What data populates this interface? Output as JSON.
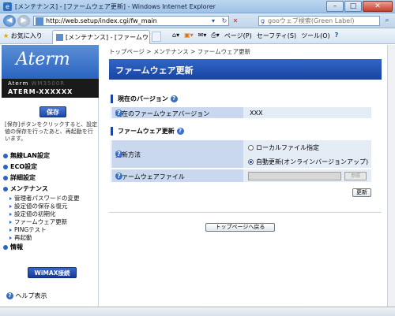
{
  "window": {
    "title": "[メンテナンス] - [ファームウェア更新] - Windows Internet Explorer",
    "minimize": "–",
    "maximize": "□",
    "close": "✕"
  },
  "address": {
    "url": "http://web.setup/index.cgi/fw_main",
    "search_placeholder": "gooウェブ検索(Green Label)"
  },
  "commandbar": {
    "favorites": "お気に入り",
    "tab_label": "[メンテナンス] - [ファームウェ...",
    "page_menu": "ページ(P)",
    "safety_menu": "セーフティ(S)",
    "tools_menu": "ツール(O)",
    "help_menu": "?"
  },
  "sidebar": {
    "logo": "Aterm",
    "model_line1": "Aterm",
    "model_line1_blur": "WM3500R",
    "model_line2": "ATERM-XXXXXX",
    "save_button": "保存",
    "save_note": "[保存]ボタンをクリックすると、設定値の保存を行ったあと、再起動を行います。",
    "menu": [
      {
        "label": "無線LAN設定"
      },
      {
        "label": "ECO設定"
      },
      {
        "label": "詳細設定"
      },
      {
        "label": "メンテナンス"
      }
    ],
    "submenu": [
      {
        "label": "管理者パスワードの変更"
      },
      {
        "label": "設定値の保存＆復元"
      },
      {
        "label": "設定値の初期化"
      },
      {
        "label": "ファームウェア更新"
      },
      {
        "label": "PINGテスト"
      },
      {
        "label": "再起動"
      }
    ],
    "info": "情報",
    "wimax_button": "WiMAX接続",
    "help": "ヘルプ表示"
  },
  "main": {
    "breadcrumb": "トップページ > メンテナンス > ファームウェア更新",
    "title": "ファームウェア更新",
    "current_version_section": "現在のバージョン",
    "current_version_label": "現在のファームウェアバージョン",
    "current_version_value": "XXX",
    "fw_update_section": "ファームウェア更新",
    "update_method_label": "更新方法",
    "option_local": "ローカルファイル指定",
    "option_auto": "自動更新(オンラインバージョンアップ)",
    "fw_file_label": "ファームウェアファイル",
    "browse_button": "参照",
    "update_button": "更新",
    "back_to_top_button": "トップページへ戻る"
  }
}
